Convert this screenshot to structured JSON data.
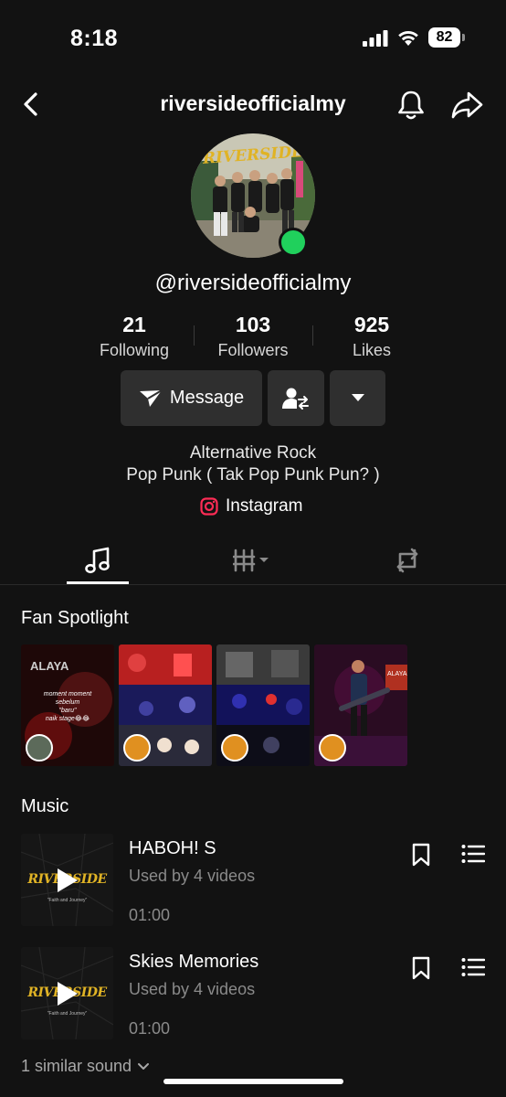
{
  "status_bar": {
    "time": "8:18",
    "battery": "82"
  },
  "header": {
    "title": "riversideofficialmy"
  },
  "profile": {
    "handle": "@riversideofficialmy",
    "avatar_text": "RIVERSIDE",
    "online_color": "#20d05c"
  },
  "stats": [
    {
      "value": "21",
      "label": "Following"
    },
    {
      "value": "103",
      "label": "Followers"
    },
    {
      "value": "925",
      "label": "Likes"
    }
  ],
  "actions": {
    "message_label": "Message"
  },
  "bio": {
    "line1": "Alternative Rock",
    "line2": "Pop Punk ( Tak Pop Punk Pun? )"
  },
  "link": {
    "label": "Instagram",
    "icon": "instagram-icon"
  },
  "tabs": [
    {
      "name": "music",
      "icon": "music-note-icon",
      "active": true
    },
    {
      "name": "videos",
      "icon": "grid-icon",
      "active": false
    },
    {
      "name": "reposts",
      "icon": "repost-icon",
      "active": false
    }
  ],
  "fan_spotlight": {
    "title": "Fan Spotlight",
    "thumb1_text": [
      "moment moment",
      "sebelum",
      "\"baru\"",
      "naik stage😂😂"
    ]
  },
  "music": {
    "title": "Music",
    "tracks": [
      {
        "name": "HABOH! S",
        "used": "Used by 4 videos",
        "duration": "01:00",
        "cover_text": "RIVERSIDE",
        "cover_sub": "\"Faith and Journey\""
      },
      {
        "name": "Skies Memories",
        "used": "Used by 4 videos",
        "duration": "01:00",
        "cover_text": "RIVERSIDE",
        "cover_sub": "\"Faith and Journey\""
      }
    ],
    "similar": "1 similar sound"
  },
  "colors": {
    "background": "#121212",
    "button_bg": "#2f2f2f",
    "accent_pink": "#fe2c55",
    "muted": "#8a8a8a"
  }
}
